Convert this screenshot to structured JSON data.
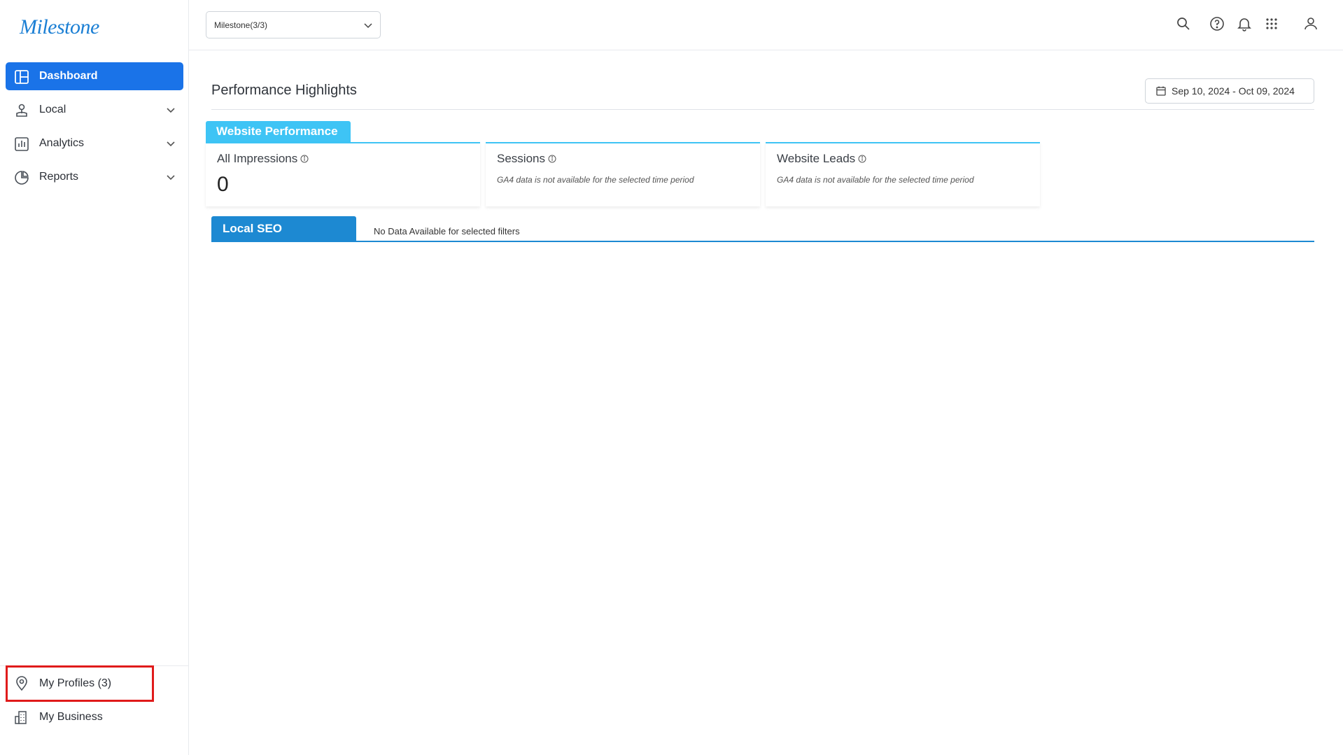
{
  "sidebar": {
    "logo": "Milestone",
    "items": [
      {
        "label": "Dashboard",
        "icon": "dashboard-icon",
        "active": true
      },
      {
        "label": "Local",
        "icon": "local-pin-icon",
        "expandable": true
      },
      {
        "label": "Analytics",
        "icon": "analytics-chart-icon",
        "expandable": true
      },
      {
        "label": "Reports",
        "icon": "pie-chart-icon",
        "expandable": true
      }
    ],
    "bottom": [
      {
        "label": "My Profiles (3)",
        "icon": "location-pin-icon",
        "highlighted": true
      },
      {
        "label": "My Business",
        "icon": "building-icon"
      }
    ]
  },
  "topbar": {
    "selector_value": "Milestone(3/3)",
    "icons": [
      "search-icon",
      "help-icon",
      "bell-icon",
      "apps-grid-icon",
      "user-icon"
    ]
  },
  "main": {
    "title": "Performance Highlights",
    "date_range": "Sep 10, 2024 - Oct 09, 2024",
    "website_performance": {
      "tab_label": "Website Performance",
      "cards": [
        {
          "title": "All Impressions",
          "value": "0"
        },
        {
          "title": "Sessions",
          "note": "GA4 data is not available for the selected time period"
        },
        {
          "title": "Website Leads",
          "note": "GA4 data is not available for the selected time period"
        }
      ]
    },
    "local_seo": {
      "tab_label": "Local SEO",
      "message": "No Data Available for selected filters"
    }
  },
  "colors": {
    "primary": "#1a73e8",
    "website_tab": "#3ec4f5",
    "seo_tab": "#1d89d2",
    "logo": "#1b7fd4",
    "highlight": "#e01b1b"
  }
}
